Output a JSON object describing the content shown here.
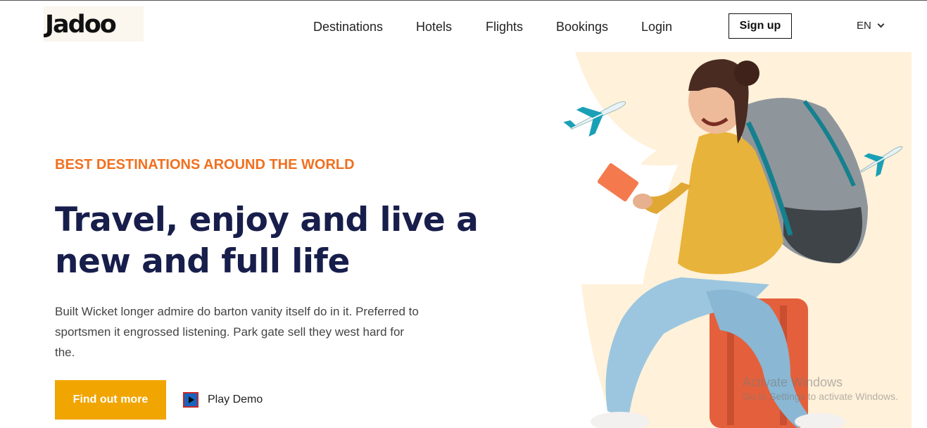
{
  "header": {
    "logo_text": "Jadoo",
    "nav": {
      "destinations": "Destinations",
      "hotels": "Hotels",
      "flights": "Flights",
      "bookings": "Bookings",
      "login": "Login"
    },
    "signup_label": "Sign up",
    "language": "EN"
  },
  "hero": {
    "eyebrow": "BEST DESTINATIONS AROUND THE WORLD",
    "headline": "Travel, enjoy and live a new and full life",
    "description": "Built Wicket longer admire do barton vanity itself do in it. Preferred to sportsmen it engrossed listening. Park gate sell they west hard for the.",
    "cta_label": "Find out more",
    "play_label": "Play Demo"
  },
  "watermark": {
    "line1": "Activate Windows",
    "line2": "Go to Settings to activate Windows."
  },
  "colors": {
    "accent_orange": "#F1701F",
    "cta_yellow": "#F1A501",
    "navy": "#181E4B",
    "hero_bg": "#FFF1DA"
  }
}
